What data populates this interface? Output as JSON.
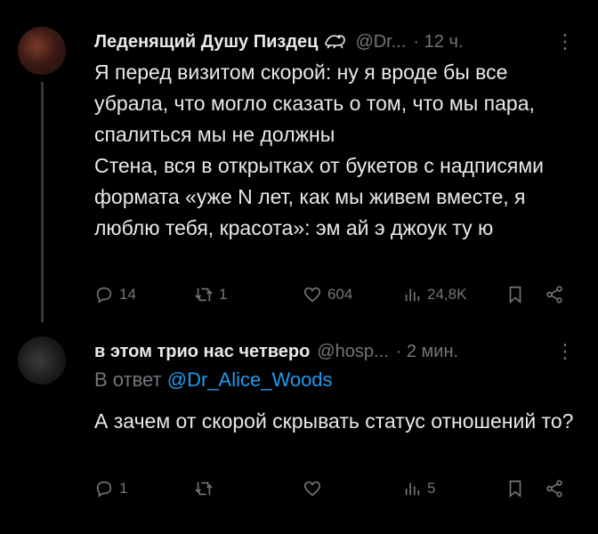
{
  "tweets": [
    {
      "author_name": "Леденящий Душу Пиздец",
      "badge_icon": "frog-icon",
      "handle": "@Dr...",
      "time": "· 12 ч.",
      "text": "Я перед визитом скорой: ну я вроде бы все убрала, что могло сказать о том, что мы пара, спалиться мы не должны\nСтена, вся в открытках от букетов с надписями формата «уже N лет, как мы живем вместе, я люблю тебя, красота»: эм ай э джоук ту ю",
      "replies": "14",
      "retweets": "1",
      "likes": "604",
      "views": "24,8K"
    },
    {
      "author_name": "в этом трио нас четверо",
      "handle": "@hosp...",
      "time": "· 2 мин.",
      "reply_prefix": "В ответ",
      "reply_mention": "@Dr_Alice_Woods",
      "text": "А зачем от скорой скрывать статус отношений то?",
      "replies": "1",
      "retweets": "",
      "likes": "",
      "views": "5"
    }
  ],
  "colors": {
    "background": "#000000",
    "text": "#e7e9ea",
    "muted": "#71767b",
    "link": "#1d9bf0"
  }
}
